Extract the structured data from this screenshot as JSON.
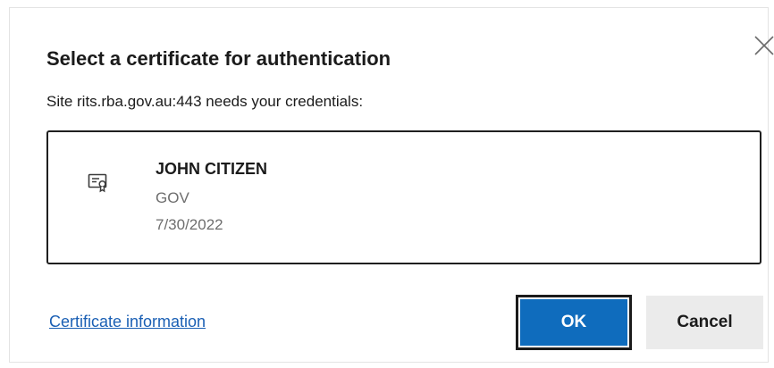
{
  "dialog": {
    "title": "Select a certificate for authentication",
    "subtitle": "Site rits.rba.gov.au:443 needs your credentials:",
    "close_icon": "close-icon"
  },
  "certificates": [
    {
      "icon": "certificate-icon",
      "name": "JOHN CITIZEN",
      "issuer": "GOV",
      "date": "7/30/2022"
    }
  ],
  "footer": {
    "cert_info_link": "Certificate information",
    "ok_label": "OK",
    "cancel_label": "Cancel"
  },
  "colors": {
    "primary_button": "#0f6cbd",
    "link": "#1a5fb4",
    "secondary_button": "#ebebeb",
    "secondary_text": "#6e6e6e"
  }
}
